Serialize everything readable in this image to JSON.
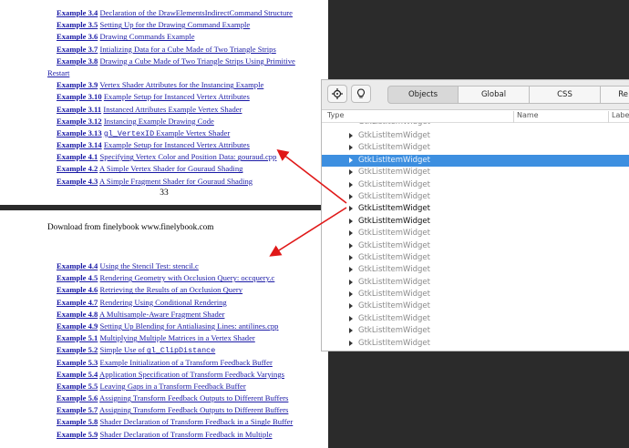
{
  "document": {
    "toc_top": [
      {
        "label": "Example 3.4",
        "title": "Declaration of the DrawElementsIndirectCommand Structure"
      },
      {
        "label": "Example 3.5",
        "title": "Setting Up for the Drawing Command Example"
      },
      {
        "label": "Example 3.6",
        "title": "Drawing Commands Example"
      },
      {
        "label": "Example 3.7",
        "title": "Intializing Data for a Cube Made of Two Triangle Strips"
      },
      {
        "label": "Example 3.8",
        "title": "Drawing a Cube Made of Two Triangle Strips Using Primitive"
      },
      {
        "label": "",
        "title": "Restart"
      },
      {
        "label": "Example 3.9",
        "title": "Vertex Shader Attributes for the Instancing Example"
      },
      {
        "label": "Example 3.10",
        "title": "Example Setup for Instanced Vertex Attributes"
      },
      {
        "label": "Example 3.11",
        "title": "Instanced Attributes Example Vertex Shader"
      },
      {
        "label": "Example 3.12",
        "title": "Instancing Example Drawing Code"
      },
      {
        "label": "Example 3.13",
        "mono": "gl_VertexID",
        "title": " Example Vertex Shader"
      },
      {
        "label": "Example 3.14",
        "title": "Example Setup for Instanced Vertex Attributes"
      },
      {
        "label": "Example 4.1",
        "title": "Specifying Vertex Color and Position Data: gouraud.cpp"
      },
      {
        "label": "Example 4.2",
        "title": "A Simple Vertex Shader for Gouraud Shading"
      },
      {
        "label": "Example 4.3",
        "title": "A Simple Fragment Shader for Gouraud Shading"
      }
    ],
    "page_number": "33",
    "download_text": "Download from finelybook www.finelybook.com",
    "toc_bottom": [
      {
        "label": "Example 4.4",
        "title": "Using the Stencil Test: stencil.c"
      },
      {
        "label": "Example 4.5",
        "title": "Rendering Geometry with Occlusion Query: occquery.c"
      },
      {
        "label": "Example 4.6",
        "title": "Retrieving the Results of an Occlusion Query"
      },
      {
        "label": "Example 4.7",
        "title": "Rendering Using Conditional Rendering"
      },
      {
        "label": "Example 4.8",
        "title": "A Multisample-Aware Fragment Shader"
      },
      {
        "label": "Example 4.9",
        "title": "Setting Up Blending for Antialiasing Lines: antilines.cpp"
      },
      {
        "label": "Example 5.1",
        "title": "Multiplying Multiple Matrices in a Vertex Shader"
      },
      {
        "label": "Example 5.2",
        "title": "Simple Use of ",
        "mono": "gl_ClipDistance"
      },
      {
        "label": "Example 5.3",
        "title": "Example Initialization of a Transform Feedback Buffer"
      },
      {
        "label": "Example 5.4",
        "title": "Application Specification of Transform Feedback Varyings"
      },
      {
        "label": "Example 5.5",
        "title": "Leaving Gaps in a Transform Feedback Buffer"
      },
      {
        "label": "Example 5.6",
        "title": "Assigning Transform Feedback Outputs to Different Buffers"
      },
      {
        "label": "Example 5.7",
        "title": "Assigning Transform Feedback Outputs to Different Buffers"
      },
      {
        "label": "Example 5.8",
        "title": "Shader Declaration of Transform Feedback in a Single Buffer"
      },
      {
        "label": "Example 5.9",
        "title": "Shader Declaration of Transform Feedback in Multiple"
      }
    ]
  },
  "inspector": {
    "tabs": [
      "Objects",
      "Global",
      "CSS",
      "Re"
    ],
    "active_tab": "Objects",
    "columns": {
      "type": "Type",
      "name": "Name",
      "label": "Labe"
    },
    "rows": [
      {
        "text": "GtkListItemWidget",
        "state": "partial"
      },
      {
        "text": "GtkListItemWidget",
        "state": "normal"
      },
      {
        "text": "GtkListItemWidget",
        "state": "normal"
      },
      {
        "text": "GtkListItemWidget",
        "state": "selected"
      },
      {
        "text": "GtkListItemWidget",
        "state": "normal"
      },
      {
        "text": "GtkListItemWidget",
        "state": "normal"
      },
      {
        "text": "GtkListItemWidget",
        "state": "normal"
      },
      {
        "text": "GtkListItemWidget",
        "state": "bold"
      },
      {
        "text": "GtkListItemWidget",
        "state": "bold"
      },
      {
        "text": "GtkListItemWidget",
        "state": "normal"
      },
      {
        "text": "GtkListItemWidget",
        "state": "normal"
      },
      {
        "text": "GtkListItemWidget",
        "state": "normal"
      },
      {
        "text": "GtkListItemWidget",
        "state": "normal"
      },
      {
        "text": "GtkListItemWidget",
        "state": "normal"
      },
      {
        "text": "GtkListItemWidget",
        "state": "normal"
      },
      {
        "text": "GtkListItemWidget",
        "state": "normal"
      },
      {
        "text": "GtkListItemWidget",
        "state": "normal"
      },
      {
        "text": "GtkListItemWidget",
        "state": "normal"
      },
      {
        "text": "GtkListItemWidget",
        "state": "normal"
      },
      {
        "text": "GtkListItemWidget",
        "state": "normal"
      }
    ],
    "icons": [
      "crosshair-icon",
      "lightbulb-icon"
    ]
  },
  "colors": {
    "link": "#1a1aa6",
    "selection": "#3d8fe0",
    "annotation_arrow": "#e01818",
    "background": "#2b2b2b"
  }
}
